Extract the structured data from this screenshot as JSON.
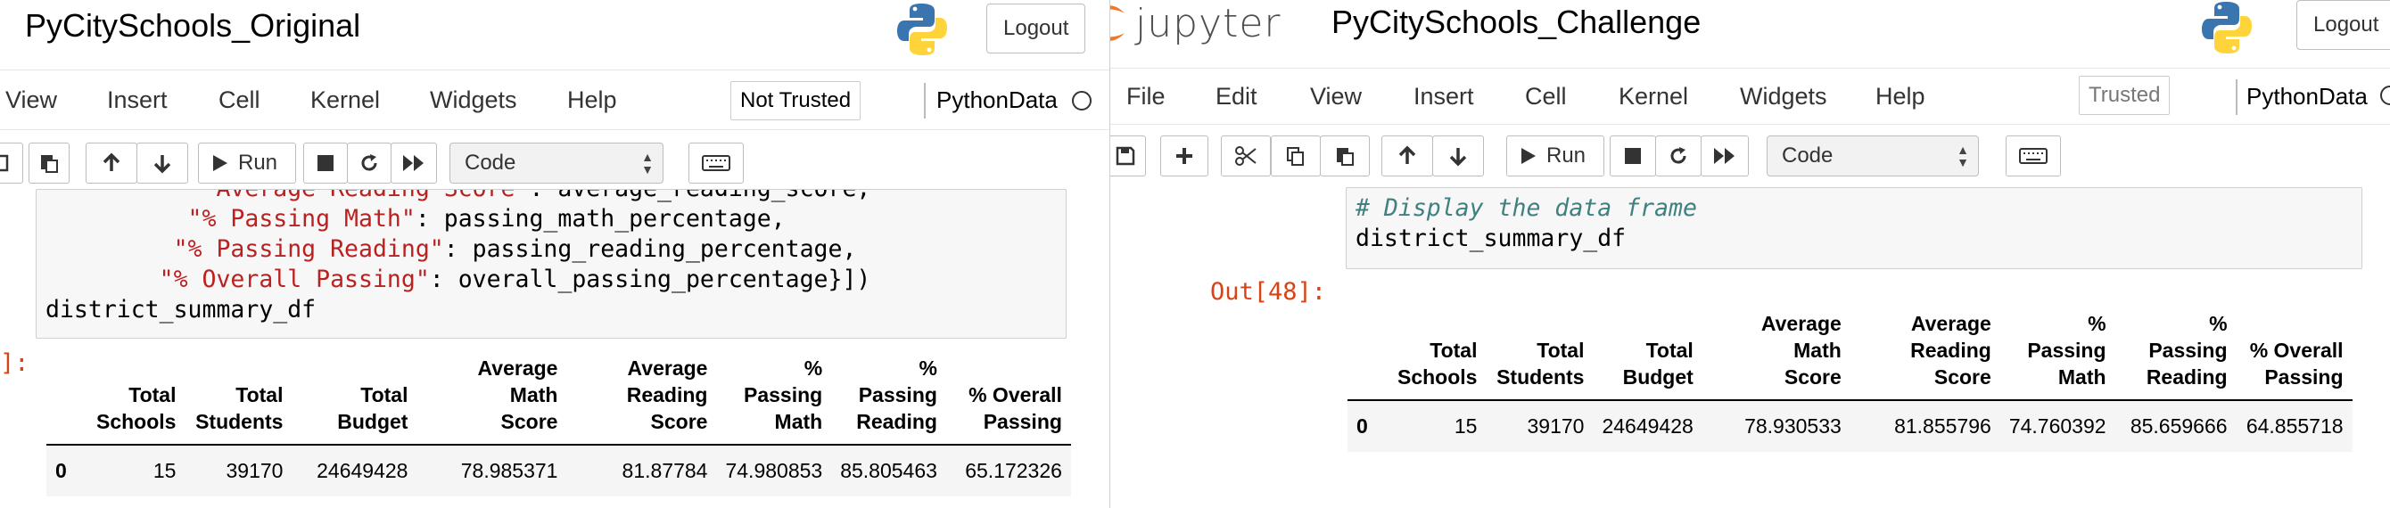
{
  "left": {
    "notebook_title": "PyCitySchools_Original",
    "logout": "Logout",
    "menu": [
      "View",
      "Insert",
      "Cell",
      "Kernel",
      "Widgets",
      "Help"
    ],
    "trust": "Not Trusted",
    "kernel": "PythonData",
    "cell_type": "Code",
    "run_label": "Run",
    "code_lines": [
      {
        "parts": [
          {
            "t": "           ",
            "c": ""
          },
          {
            "t": "\"Average Reading Score\"",
            "c": "str"
          },
          {
            "t": ": average_reading_score,",
            "c": ""
          }
        ]
      },
      {
        "parts": [
          {
            "t": "          ",
            "c": ""
          },
          {
            "t": "\"% Passing Math\"",
            "c": "str"
          },
          {
            "t": ": passing_math_percentage,",
            "c": ""
          }
        ]
      },
      {
        "parts": [
          {
            "t": "         ",
            "c": ""
          },
          {
            "t": "\"% Passing Reading\"",
            "c": "str"
          },
          {
            "t": ": passing_reading_percentage,",
            "c": ""
          }
        ]
      },
      {
        "parts": [
          {
            "t": "        ",
            "c": ""
          },
          {
            "t": "\"% Overall Passing\"",
            "c": "str"
          },
          {
            "t": ": overall_passing_percentage}])",
            "c": ""
          }
        ]
      },
      {
        "parts": [
          {
            "t": "district_summary_df",
            "c": ""
          }
        ]
      }
    ],
    "out_prompt": "]:",
    "table": {
      "headers": [
        [
          "Total",
          "Schools"
        ],
        [
          "Total",
          "Students"
        ],
        [
          "Total",
          "Budget"
        ],
        [
          "Average",
          "Math",
          "Score"
        ],
        [
          "Average",
          "Reading",
          "Score"
        ],
        [
          "%",
          "Passing",
          "Math"
        ],
        [
          "%",
          "Passing",
          "Reading"
        ],
        [
          "% Overall",
          "Passing"
        ]
      ],
      "rows": [
        {
          "index": "0",
          "values": [
            "15",
            "39170",
            "24649428",
            "78.985371",
            "81.87784",
            "74.980853",
            "85.805463",
            "65.172326"
          ]
        }
      ]
    }
  },
  "right": {
    "brand": "jupyter",
    "notebook_title": "PyCitySchools_Challenge",
    "logout": "Logout",
    "menu": [
      "File",
      "Edit",
      "View",
      "Insert",
      "Cell",
      "Kernel",
      "Widgets",
      "Help"
    ],
    "trust": "Trusted",
    "kernel": "PythonData",
    "cell_type": "Code",
    "run_label": "Run",
    "code_lines": [
      {
        "parts": [
          {
            "t": "# Display the data frame",
            "c": "cmt"
          }
        ]
      },
      {
        "parts": [
          {
            "t": "district_summary_df",
            "c": ""
          }
        ]
      }
    ],
    "out_prompt": "Out[48]:",
    "table": {
      "headers": [
        [
          "Total",
          "Schools"
        ],
        [
          "Total",
          "Students"
        ],
        [
          "Total",
          "Budget"
        ],
        [
          "Average",
          "Math",
          "Score"
        ],
        [
          "Average",
          "Reading",
          "Score"
        ],
        [
          "%",
          "Passing",
          "Math"
        ],
        [
          "%",
          "Passing",
          "Reading"
        ],
        [
          "% Overall",
          "Passing"
        ]
      ],
      "rows": [
        {
          "index": "0",
          "values": [
            "15",
            "39170",
            "24649428",
            "78.930533",
            "81.855796",
            "74.760392",
            "85.659666",
            "64.855718"
          ]
        }
      ]
    }
  },
  "colors": {
    "prompt_out": "#d84315",
    "string": "#ba2121",
    "comment": "#408080",
    "python_blue": "#3a75b0",
    "python_yellow": "#ffd43b",
    "jupyter_orange": "#f37726"
  },
  "icons": [
    "python-logo-icon",
    "jupyter-logo-icon",
    "save-icon",
    "add-cell-icon",
    "cut-icon",
    "copy-icon",
    "paste-icon",
    "move-up-icon",
    "move-down-icon",
    "run-icon",
    "stop-icon",
    "restart-icon",
    "fast-forward-icon",
    "keyboard-icon",
    "kernel-status-icon"
  ]
}
